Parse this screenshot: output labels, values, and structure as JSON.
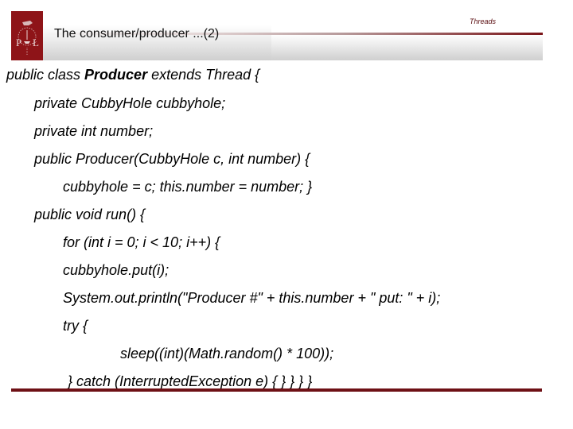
{
  "header": {
    "title": "The consumer/producer ...(2)",
    "section": "Threads",
    "logo": "university-crest-icon",
    "accent_color": "#8e1418"
  },
  "code": {
    "line1_pre": "public class ",
    "line1_bold": "Producer",
    "line1_post": " extends Thread {",
    "lines": [
      "private CubbyHole cubbyhole;",
      "private int number;",
      "public Producer(CubbyHole c, int number) {",
      "cubbyhole = c; this.number = number; }",
      "public void run() {",
      "for (int i = 0; i < 10; i++) {",
      "cubbyhole.put(i);",
      "System.out.println(\"Producer #\" + this.number + \" put: \" + i);",
      "try {",
      "sleep((int)(Math.random() * 100));",
      "} catch (InterruptedException e) { } } } }"
    ]
  }
}
